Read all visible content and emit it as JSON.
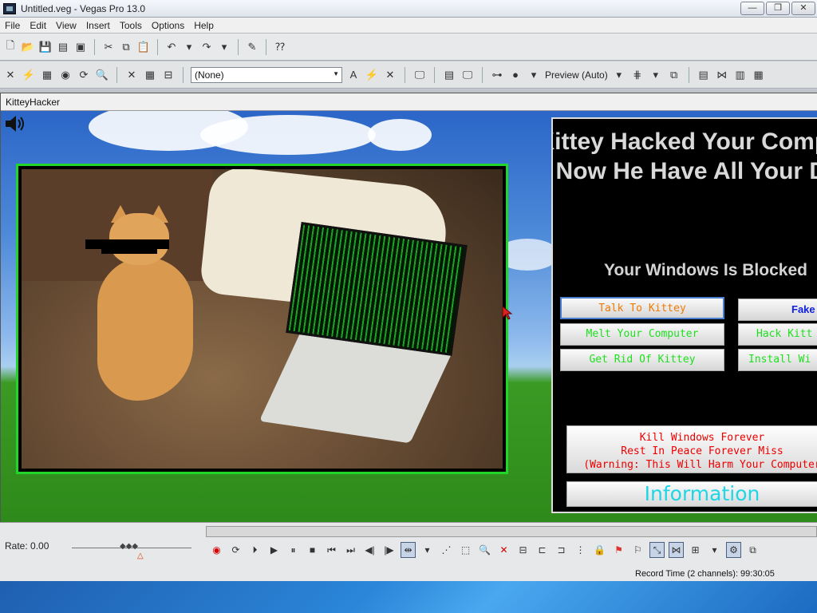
{
  "window": {
    "title": "Untitled.veg - Vegas Pro 13.0",
    "minimize": "—",
    "maximize": "❐",
    "close": "✕"
  },
  "menu": [
    "File",
    "Edit",
    "View",
    "Insert",
    "Tools",
    "Options",
    "Help"
  ],
  "toolbar2": {
    "effect_select": "(None)",
    "preview_quality": "Preview (Auto)"
  },
  "kitteyhacker": {
    "title": "KitteyHacker",
    "headline": "Kittey Hacked Your Computer. Now He Have All Your Data",
    "blocked": "Your Windows Is Blocked",
    "buttons": {
      "talk": "Talk To Kittey",
      "fake": "Fake",
      "melt": "Melt Your Computer",
      "hack": "Hack Kitt",
      "rid": "Get Rid Of Kittey",
      "install": "Install Wi"
    },
    "kill": {
      "line1": "Kill Windows Forever",
      "line2": "Rest In Peace Forever Miss",
      "line3": "(Warning: This Will Harm Your Computer"
    },
    "info": "Information"
  },
  "playback": {
    "rate": "Rate: 0.00",
    "record_time": "Record Time (2 channels): 99:30:05"
  },
  "colors": {
    "orange": "#f07a00",
    "green": "#1ee01e",
    "blue": "#1020e0",
    "cyan": "#1fd5e6",
    "red": "#e00000",
    "frame_green": "#22d52a"
  }
}
